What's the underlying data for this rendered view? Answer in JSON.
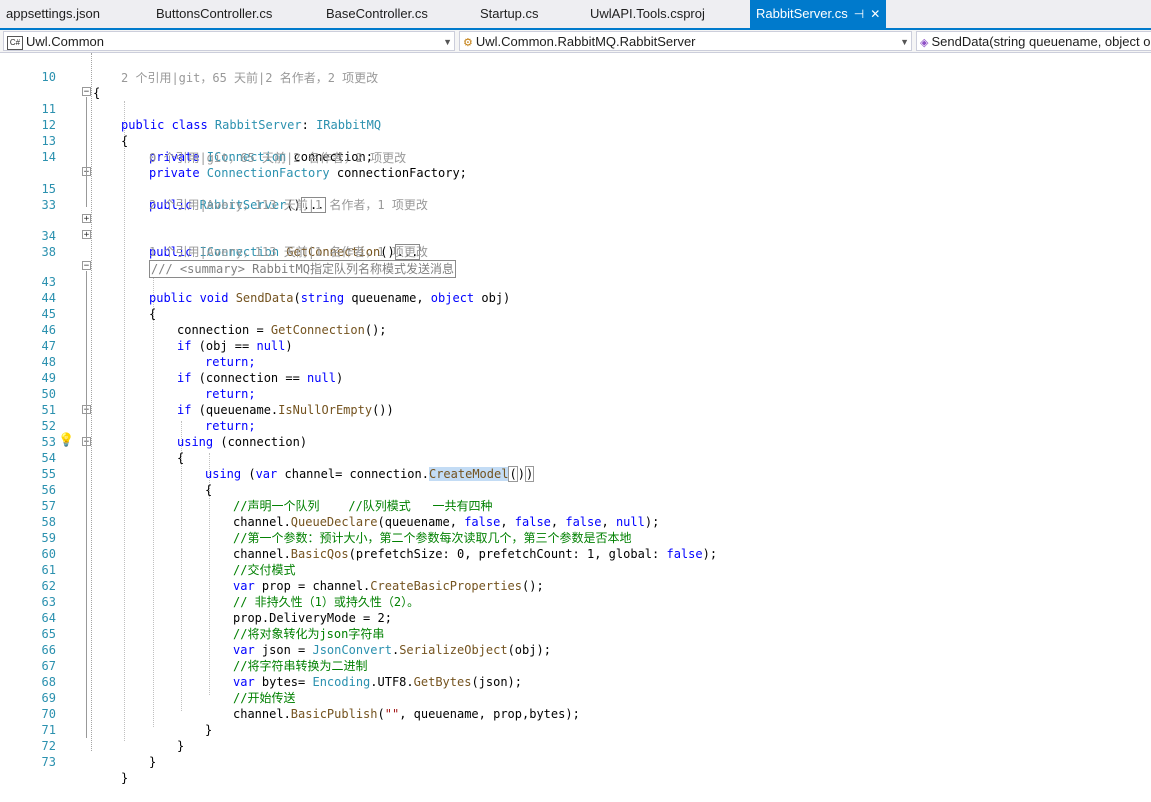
{
  "tabs": [
    {
      "label": "appsettings.json"
    },
    {
      "label": "ButtonsController.cs"
    },
    {
      "label": "BaseController.cs"
    },
    {
      "label": "Startup.cs"
    },
    {
      "label": "UwlAPI.Tools.csproj"
    },
    {
      "label": "RabbitServer.cs",
      "active": true
    }
  ],
  "navbar": {
    "project": "Uwl.Common",
    "class": "Uwl.Common.RabbitMQ.RabbitServer",
    "member": "SendData(string queuename, object o"
  },
  "lenses": {
    "class": "2 个引用|git，65 天前|2 名作者，2 项更改",
    "ctor": "0 个引用|git，65 天前|2 名作者，2 项更改",
    "getconn": "2 个引用|Avery，113 天前|1 名作者，1 项更改",
    "senddata": "1 个引用|Avery，113 天前|1 名作者，1 项更改"
  },
  "lines": [
    {
      "n": "10",
      "t": "{"
    },
    {
      "n": "11",
      "t": "public class RabbitServer: IRabbitMQ"
    },
    {
      "n": "12",
      "t": "{"
    },
    {
      "n": "13",
      "t": "private IConnection connection;"
    },
    {
      "n": "14",
      "t": "private ConnectionFactory connectionFactory;"
    },
    {
      "n": "15",
      "t": "public RabbitServer()"
    },
    {
      "n": "33",
      "t": ""
    },
    {
      "n": "34",
      "t": "public IConnection GetConnection()"
    },
    {
      "n": "38",
      "t": "/// <summary> RabbitMQ指定队列名称模式发送消息"
    },
    {
      "n": "43",
      "t": "public void SendData(string queuename, object obj)"
    },
    {
      "n": "44",
      "t": "{"
    },
    {
      "n": "45",
      "t": "connection = GetConnection();"
    },
    {
      "n": "46",
      "t": "if (obj == null)"
    },
    {
      "n": "47",
      "t": "return;"
    },
    {
      "n": "48",
      "t": "if (connection == null)"
    },
    {
      "n": "49",
      "t": "return;"
    },
    {
      "n": "50",
      "t": "if (queuename.IsNullOrEmpty())"
    },
    {
      "n": "51",
      "t": "return;"
    },
    {
      "n": "52",
      "t": "using (connection)"
    },
    {
      "n": "53",
      "t": "{"
    },
    {
      "n": "54",
      "t": "using (var channel= connection.CreateModel())"
    },
    {
      "n": "55",
      "t": "{"
    },
    {
      "n": "56",
      "t": "//声明一个队列    //队列模式   一共有四种"
    },
    {
      "n": "57",
      "t": "channel.QueueDeclare(queuename, false, false, false, null);"
    },
    {
      "n": "58",
      "t": "//第一个参数：预计大小，第二个参数每次读取几个，第三个参数是否本地"
    },
    {
      "n": "59",
      "t": "channel.BasicQos(prefetchSize: 0, prefetchCount: 1, global: false);"
    },
    {
      "n": "60",
      "t": "//交付模式"
    },
    {
      "n": "61",
      "t": "var prop = channel.CreateBasicProperties();"
    },
    {
      "n": "62",
      "t": "// 非持久性（1）或持久性（2）。"
    },
    {
      "n": "63",
      "t": "prop.DeliveryMode = 2;"
    },
    {
      "n": "64",
      "t": "//将对象转化为json字符串"
    },
    {
      "n": "65",
      "t": "var json = JsonConvert.SerializeObject(obj);"
    },
    {
      "n": "66",
      "t": "//将字符串转换为二进制"
    },
    {
      "n": "67",
      "t": "var bytes= Encoding.UTF8.GetBytes(json);"
    },
    {
      "n": "68",
      "t": "//开始传送"
    },
    {
      "n": "69",
      "t": "channel.BasicPublish(\"\", queuename, prop,bytes);"
    },
    {
      "n": "70",
      "t": "}"
    },
    {
      "n": "71",
      "t": "}"
    },
    {
      "n": "72",
      "t": "}"
    },
    {
      "n": "73",
      "t": "}"
    }
  ],
  "colors": {
    "accent": "#007acc",
    "keyword": "#0000ff",
    "type": "#2b91af",
    "comment": "#008000",
    "lens": "#999999",
    "linenumber": "#2b91af"
  },
  "icons": {
    "lightbulb": "lightbulb-icon",
    "csharp": "csharp-file-icon"
  }
}
